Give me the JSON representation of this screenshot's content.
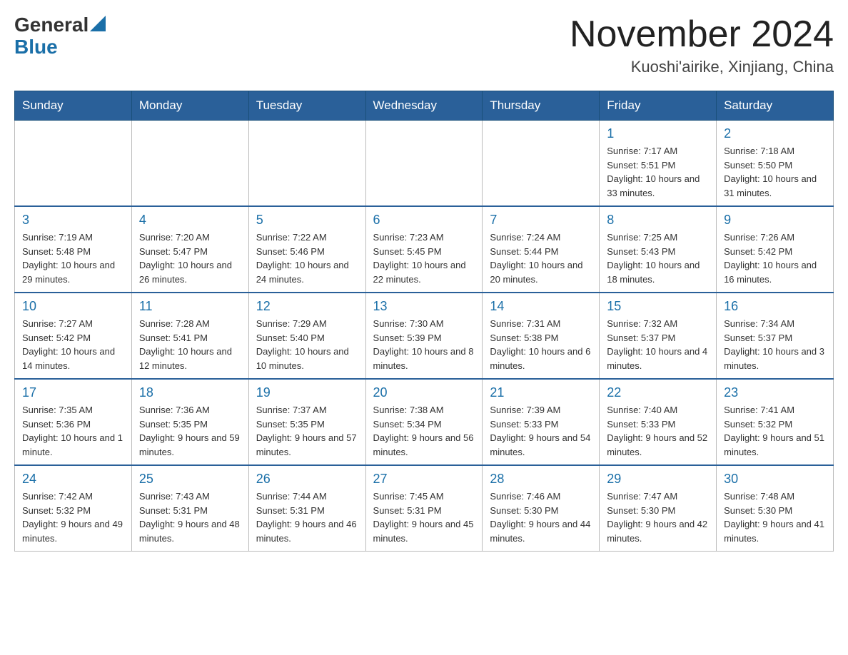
{
  "header": {
    "logo_general": "General",
    "logo_blue": "Blue",
    "month_title": "November 2024",
    "location": "Kuoshi'airike, Xinjiang, China"
  },
  "days_of_week": [
    "Sunday",
    "Monday",
    "Tuesday",
    "Wednesday",
    "Thursday",
    "Friday",
    "Saturday"
  ],
  "weeks": [
    [
      {
        "day": "",
        "sunrise": "",
        "sunset": "",
        "daylight": ""
      },
      {
        "day": "",
        "sunrise": "",
        "sunset": "",
        "daylight": ""
      },
      {
        "day": "",
        "sunrise": "",
        "sunset": "",
        "daylight": ""
      },
      {
        "day": "",
        "sunrise": "",
        "sunset": "",
        "daylight": ""
      },
      {
        "day": "",
        "sunrise": "",
        "sunset": "",
        "daylight": ""
      },
      {
        "day": "1",
        "sunrise": "Sunrise: 7:17 AM",
        "sunset": "Sunset: 5:51 PM",
        "daylight": "Daylight: 10 hours and 33 minutes."
      },
      {
        "day": "2",
        "sunrise": "Sunrise: 7:18 AM",
        "sunset": "Sunset: 5:50 PM",
        "daylight": "Daylight: 10 hours and 31 minutes."
      }
    ],
    [
      {
        "day": "3",
        "sunrise": "Sunrise: 7:19 AM",
        "sunset": "Sunset: 5:48 PM",
        "daylight": "Daylight: 10 hours and 29 minutes."
      },
      {
        "day": "4",
        "sunrise": "Sunrise: 7:20 AM",
        "sunset": "Sunset: 5:47 PM",
        "daylight": "Daylight: 10 hours and 26 minutes."
      },
      {
        "day": "5",
        "sunrise": "Sunrise: 7:22 AM",
        "sunset": "Sunset: 5:46 PM",
        "daylight": "Daylight: 10 hours and 24 minutes."
      },
      {
        "day": "6",
        "sunrise": "Sunrise: 7:23 AM",
        "sunset": "Sunset: 5:45 PM",
        "daylight": "Daylight: 10 hours and 22 minutes."
      },
      {
        "day": "7",
        "sunrise": "Sunrise: 7:24 AM",
        "sunset": "Sunset: 5:44 PM",
        "daylight": "Daylight: 10 hours and 20 minutes."
      },
      {
        "day": "8",
        "sunrise": "Sunrise: 7:25 AM",
        "sunset": "Sunset: 5:43 PM",
        "daylight": "Daylight: 10 hours and 18 minutes."
      },
      {
        "day": "9",
        "sunrise": "Sunrise: 7:26 AM",
        "sunset": "Sunset: 5:42 PM",
        "daylight": "Daylight: 10 hours and 16 minutes."
      }
    ],
    [
      {
        "day": "10",
        "sunrise": "Sunrise: 7:27 AM",
        "sunset": "Sunset: 5:42 PM",
        "daylight": "Daylight: 10 hours and 14 minutes."
      },
      {
        "day": "11",
        "sunrise": "Sunrise: 7:28 AM",
        "sunset": "Sunset: 5:41 PM",
        "daylight": "Daylight: 10 hours and 12 minutes."
      },
      {
        "day": "12",
        "sunrise": "Sunrise: 7:29 AM",
        "sunset": "Sunset: 5:40 PM",
        "daylight": "Daylight: 10 hours and 10 minutes."
      },
      {
        "day": "13",
        "sunrise": "Sunrise: 7:30 AM",
        "sunset": "Sunset: 5:39 PM",
        "daylight": "Daylight: 10 hours and 8 minutes."
      },
      {
        "day": "14",
        "sunrise": "Sunrise: 7:31 AM",
        "sunset": "Sunset: 5:38 PM",
        "daylight": "Daylight: 10 hours and 6 minutes."
      },
      {
        "day": "15",
        "sunrise": "Sunrise: 7:32 AM",
        "sunset": "Sunset: 5:37 PM",
        "daylight": "Daylight: 10 hours and 4 minutes."
      },
      {
        "day": "16",
        "sunrise": "Sunrise: 7:34 AM",
        "sunset": "Sunset: 5:37 PM",
        "daylight": "Daylight: 10 hours and 3 minutes."
      }
    ],
    [
      {
        "day": "17",
        "sunrise": "Sunrise: 7:35 AM",
        "sunset": "Sunset: 5:36 PM",
        "daylight": "Daylight: 10 hours and 1 minute."
      },
      {
        "day": "18",
        "sunrise": "Sunrise: 7:36 AM",
        "sunset": "Sunset: 5:35 PM",
        "daylight": "Daylight: 9 hours and 59 minutes."
      },
      {
        "day": "19",
        "sunrise": "Sunrise: 7:37 AM",
        "sunset": "Sunset: 5:35 PM",
        "daylight": "Daylight: 9 hours and 57 minutes."
      },
      {
        "day": "20",
        "sunrise": "Sunrise: 7:38 AM",
        "sunset": "Sunset: 5:34 PM",
        "daylight": "Daylight: 9 hours and 56 minutes."
      },
      {
        "day": "21",
        "sunrise": "Sunrise: 7:39 AM",
        "sunset": "Sunset: 5:33 PM",
        "daylight": "Daylight: 9 hours and 54 minutes."
      },
      {
        "day": "22",
        "sunrise": "Sunrise: 7:40 AM",
        "sunset": "Sunset: 5:33 PM",
        "daylight": "Daylight: 9 hours and 52 minutes."
      },
      {
        "day": "23",
        "sunrise": "Sunrise: 7:41 AM",
        "sunset": "Sunset: 5:32 PM",
        "daylight": "Daylight: 9 hours and 51 minutes."
      }
    ],
    [
      {
        "day": "24",
        "sunrise": "Sunrise: 7:42 AM",
        "sunset": "Sunset: 5:32 PM",
        "daylight": "Daylight: 9 hours and 49 minutes."
      },
      {
        "day": "25",
        "sunrise": "Sunrise: 7:43 AM",
        "sunset": "Sunset: 5:31 PM",
        "daylight": "Daylight: 9 hours and 48 minutes."
      },
      {
        "day": "26",
        "sunrise": "Sunrise: 7:44 AM",
        "sunset": "Sunset: 5:31 PM",
        "daylight": "Daylight: 9 hours and 46 minutes."
      },
      {
        "day": "27",
        "sunrise": "Sunrise: 7:45 AM",
        "sunset": "Sunset: 5:31 PM",
        "daylight": "Daylight: 9 hours and 45 minutes."
      },
      {
        "day": "28",
        "sunrise": "Sunrise: 7:46 AM",
        "sunset": "Sunset: 5:30 PM",
        "daylight": "Daylight: 9 hours and 44 minutes."
      },
      {
        "day": "29",
        "sunrise": "Sunrise: 7:47 AM",
        "sunset": "Sunset: 5:30 PM",
        "daylight": "Daylight: 9 hours and 42 minutes."
      },
      {
        "day": "30",
        "sunrise": "Sunrise: 7:48 AM",
        "sunset": "Sunset: 5:30 PM",
        "daylight": "Daylight: 9 hours and 41 minutes."
      }
    ]
  ]
}
